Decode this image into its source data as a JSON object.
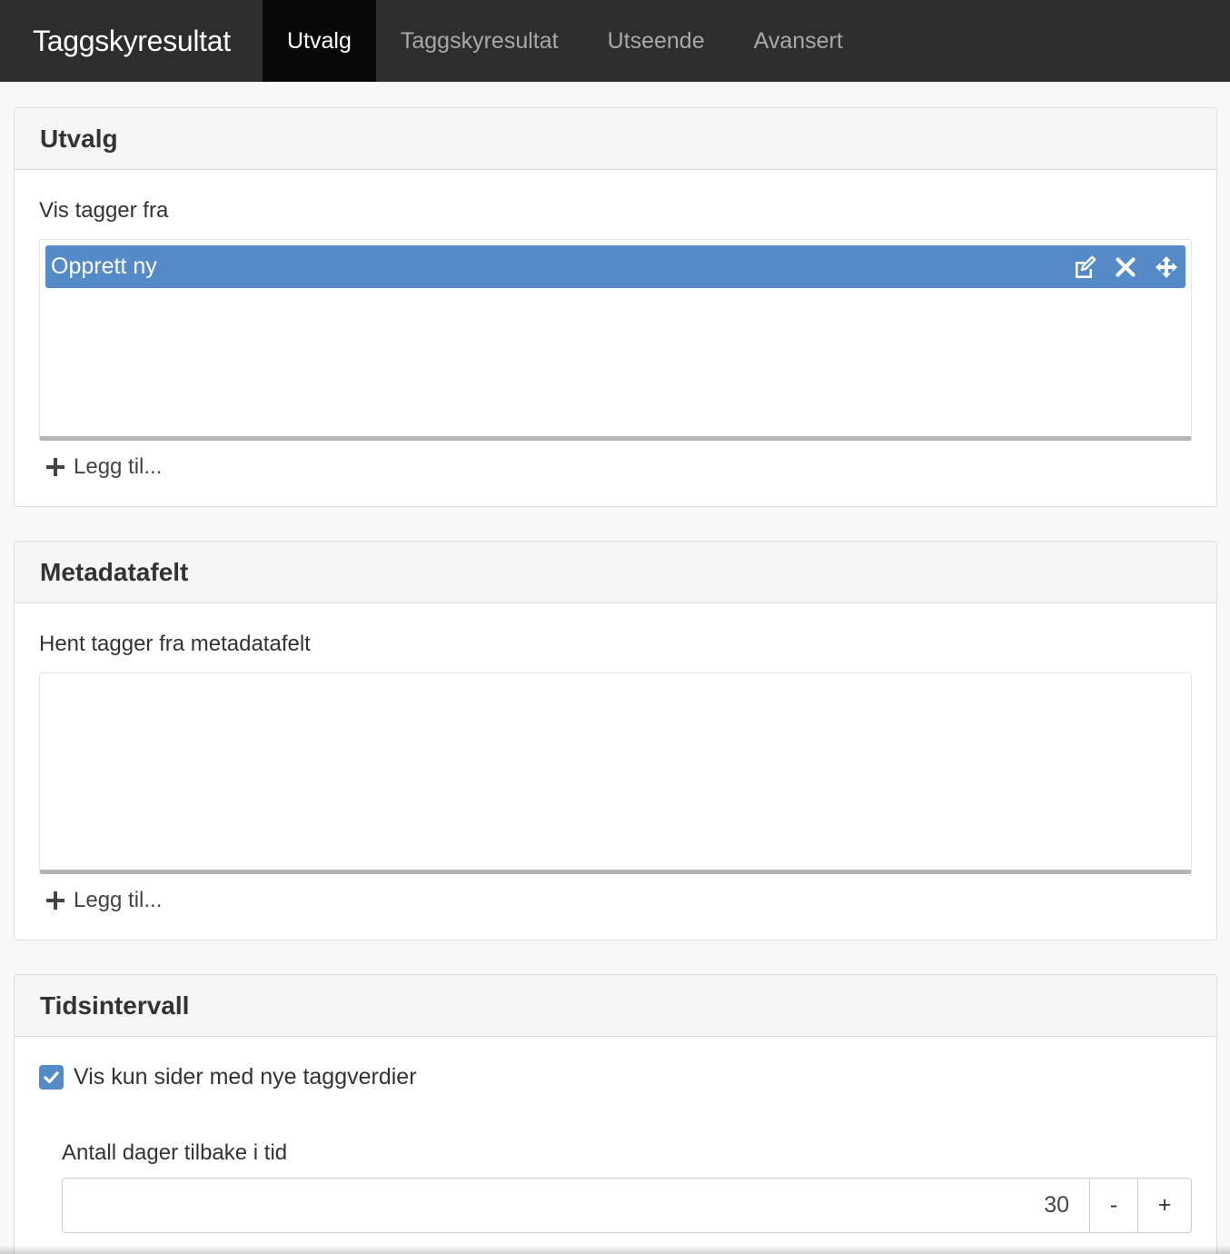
{
  "navbar": {
    "brand": "Taggskyresultat",
    "tabs": [
      {
        "label": "Utvalg",
        "active": true
      },
      {
        "label": "Taggskyresultat",
        "active": false
      },
      {
        "label": "Utseende",
        "active": false
      },
      {
        "label": "Avansert",
        "active": false
      }
    ]
  },
  "colors": {
    "navbar_bg": "#2d2d2d",
    "active_tab_bg": "#080808",
    "accent": "#548ac7"
  },
  "panels": {
    "utvalg": {
      "title": "Utvalg",
      "field_label": "Vis tagger fra",
      "items": [
        {
          "label": "Opprett ny",
          "icons": [
            "edit-icon",
            "close-icon",
            "move-icon"
          ]
        }
      ],
      "add_label": "Legg til..."
    },
    "metadata": {
      "title": "Metadatafelt",
      "field_label": "Hent tagger fra metadatafelt",
      "items": [],
      "add_label": "Legg til..."
    },
    "tidsintervall": {
      "title": "Tidsintervall",
      "checkbox_label": "Vis kun sider med nye taggverdier",
      "checkbox_checked": true,
      "days_label": "Antall dager tilbake i tid",
      "days_value": "30",
      "minus_label": "-",
      "plus_label": "+"
    }
  }
}
